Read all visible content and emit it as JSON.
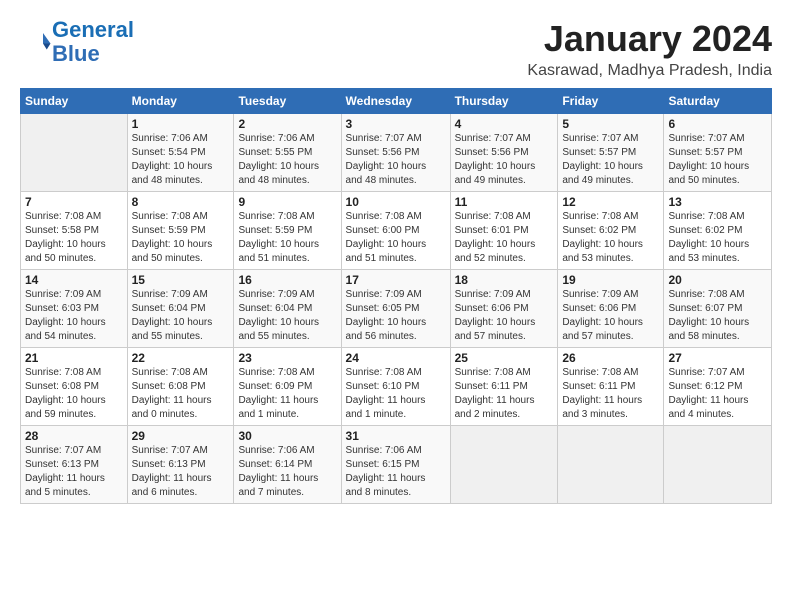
{
  "header": {
    "logo_line1": "General",
    "logo_line2": "Blue",
    "month_year": "January 2024",
    "location": "Kasrawad, Madhya Pradesh, India"
  },
  "days_of_week": [
    "Sunday",
    "Monday",
    "Tuesday",
    "Wednesday",
    "Thursday",
    "Friday",
    "Saturday"
  ],
  "weeks": [
    [
      {
        "day": "",
        "info": ""
      },
      {
        "day": "1",
        "info": "Sunrise: 7:06 AM\nSunset: 5:54 PM\nDaylight: 10 hours\nand 48 minutes."
      },
      {
        "day": "2",
        "info": "Sunrise: 7:06 AM\nSunset: 5:55 PM\nDaylight: 10 hours\nand 48 minutes."
      },
      {
        "day": "3",
        "info": "Sunrise: 7:07 AM\nSunset: 5:56 PM\nDaylight: 10 hours\nand 48 minutes."
      },
      {
        "day": "4",
        "info": "Sunrise: 7:07 AM\nSunset: 5:56 PM\nDaylight: 10 hours\nand 49 minutes."
      },
      {
        "day": "5",
        "info": "Sunrise: 7:07 AM\nSunset: 5:57 PM\nDaylight: 10 hours\nand 49 minutes."
      },
      {
        "day": "6",
        "info": "Sunrise: 7:07 AM\nSunset: 5:57 PM\nDaylight: 10 hours\nand 50 minutes."
      }
    ],
    [
      {
        "day": "7",
        "info": "Sunrise: 7:08 AM\nSunset: 5:58 PM\nDaylight: 10 hours\nand 50 minutes."
      },
      {
        "day": "8",
        "info": "Sunrise: 7:08 AM\nSunset: 5:59 PM\nDaylight: 10 hours\nand 50 minutes."
      },
      {
        "day": "9",
        "info": "Sunrise: 7:08 AM\nSunset: 5:59 PM\nDaylight: 10 hours\nand 51 minutes."
      },
      {
        "day": "10",
        "info": "Sunrise: 7:08 AM\nSunset: 6:00 PM\nDaylight: 10 hours\nand 51 minutes."
      },
      {
        "day": "11",
        "info": "Sunrise: 7:08 AM\nSunset: 6:01 PM\nDaylight: 10 hours\nand 52 minutes."
      },
      {
        "day": "12",
        "info": "Sunrise: 7:08 AM\nSunset: 6:02 PM\nDaylight: 10 hours\nand 53 minutes."
      },
      {
        "day": "13",
        "info": "Sunrise: 7:08 AM\nSunset: 6:02 PM\nDaylight: 10 hours\nand 53 minutes."
      }
    ],
    [
      {
        "day": "14",
        "info": "Sunrise: 7:09 AM\nSunset: 6:03 PM\nDaylight: 10 hours\nand 54 minutes."
      },
      {
        "day": "15",
        "info": "Sunrise: 7:09 AM\nSunset: 6:04 PM\nDaylight: 10 hours\nand 55 minutes."
      },
      {
        "day": "16",
        "info": "Sunrise: 7:09 AM\nSunset: 6:04 PM\nDaylight: 10 hours\nand 55 minutes."
      },
      {
        "day": "17",
        "info": "Sunrise: 7:09 AM\nSunset: 6:05 PM\nDaylight: 10 hours\nand 56 minutes."
      },
      {
        "day": "18",
        "info": "Sunrise: 7:09 AM\nSunset: 6:06 PM\nDaylight: 10 hours\nand 57 minutes."
      },
      {
        "day": "19",
        "info": "Sunrise: 7:09 AM\nSunset: 6:06 PM\nDaylight: 10 hours\nand 57 minutes."
      },
      {
        "day": "20",
        "info": "Sunrise: 7:08 AM\nSunset: 6:07 PM\nDaylight: 10 hours\nand 58 minutes."
      }
    ],
    [
      {
        "day": "21",
        "info": "Sunrise: 7:08 AM\nSunset: 6:08 PM\nDaylight: 10 hours\nand 59 minutes."
      },
      {
        "day": "22",
        "info": "Sunrise: 7:08 AM\nSunset: 6:08 PM\nDaylight: 11 hours\nand 0 minutes."
      },
      {
        "day": "23",
        "info": "Sunrise: 7:08 AM\nSunset: 6:09 PM\nDaylight: 11 hours\nand 1 minute."
      },
      {
        "day": "24",
        "info": "Sunrise: 7:08 AM\nSunset: 6:10 PM\nDaylight: 11 hours\nand 1 minute."
      },
      {
        "day": "25",
        "info": "Sunrise: 7:08 AM\nSunset: 6:11 PM\nDaylight: 11 hours\nand 2 minutes."
      },
      {
        "day": "26",
        "info": "Sunrise: 7:08 AM\nSunset: 6:11 PM\nDaylight: 11 hours\nand 3 minutes."
      },
      {
        "day": "27",
        "info": "Sunrise: 7:07 AM\nSunset: 6:12 PM\nDaylight: 11 hours\nand 4 minutes."
      }
    ],
    [
      {
        "day": "28",
        "info": "Sunrise: 7:07 AM\nSunset: 6:13 PM\nDaylight: 11 hours\nand 5 minutes."
      },
      {
        "day": "29",
        "info": "Sunrise: 7:07 AM\nSunset: 6:13 PM\nDaylight: 11 hours\nand 6 minutes."
      },
      {
        "day": "30",
        "info": "Sunrise: 7:06 AM\nSunset: 6:14 PM\nDaylight: 11 hours\nand 7 minutes."
      },
      {
        "day": "31",
        "info": "Sunrise: 7:06 AM\nSunset: 6:15 PM\nDaylight: 11 hours\nand 8 minutes."
      },
      {
        "day": "",
        "info": ""
      },
      {
        "day": "",
        "info": ""
      },
      {
        "day": "",
        "info": ""
      }
    ]
  ]
}
